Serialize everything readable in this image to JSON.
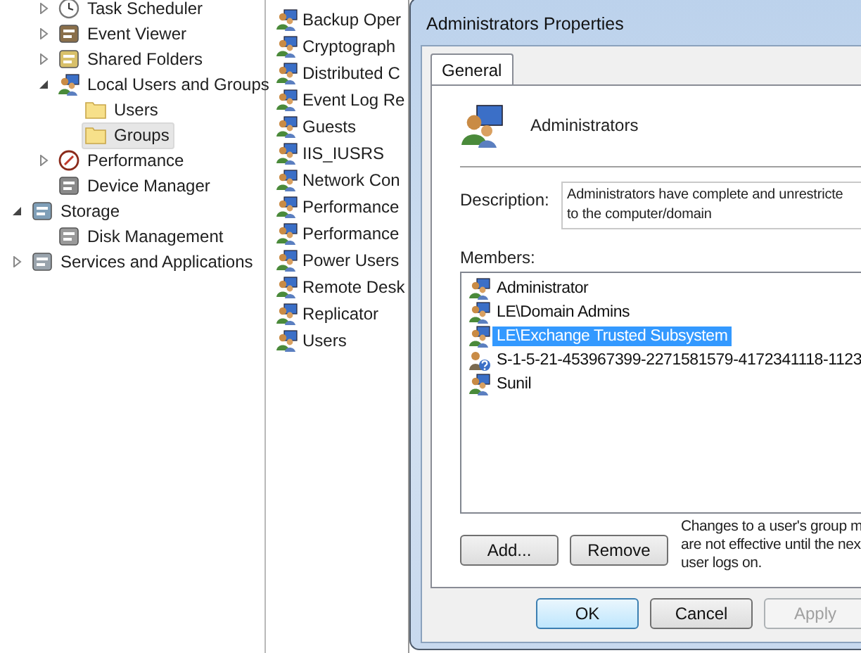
{
  "tree": [
    {
      "children": [
        {
          "label": "Task Scheduler",
          "expanded": false,
          "selected": false
        },
        {
          "label": "Event Viewer",
          "expanded": false,
          "selected": false
        },
        {
          "label": "Shared Folders",
          "expanded": false,
          "selected": false
        },
        {
          "label": "Local Users and Groups",
          "expanded": true,
          "selected": false,
          "children": [
            {
              "label": "Users",
              "selected": false
            },
            {
              "label": "Groups",
              "selected": true
            }
          ]
        },
        {
          "label": "Performance",
          "expanded": false,
          "selected": false
        },
        {
          "label": "Device Manager",
          "selected": false
        }
      ]
    },
    {
      "label": "Storage",
      "expanded": true,
      "selected": false,
      "children": [
        {
          "label": "Disk Management",
          "selected": false
        }
      ]
    },
    {
      "label": "Services and Applications",
      "expanded": false,
      "selected": false
    }
  ],
  "groups": [
    "Backup Oper",
    "Cryptograph",
    "Distributed C",
    "Event Log Re",
    "Guests",
    "IIS_IUSRS",
    "Network Con",
    "Performance",
    "Performance",
    "Power Users",
    "Remote Desk",
    "Replicator",
    "Users"
  ],
  "dialog": {
    "title": "Administrators Properties",
    "tabs": [
      {
        "label": "General",
        "selected": true
      }
    ],
    "group_name": "Administrators",
    "description_label": "Description:",
    "description_lines": [
      "Administrators have complete and unrestricte",
      "to the computer/domain"
    ],
    "members_label": "Members:",
    "members": [
      {
        "name": "Administrator",
        "kind": "user",
        "selected": false
      },
      {
        "name": "LE\\Domain Admins",
        "kind": "group",
        "selected": false
      },
      {
        "name": "LE\\Exchange Trusted Subsystem",
        "kind": "group",
        "selected": true
      },
      {
        "name": "S-1-5-21-453967399-2271581579-4172341118-1123",
        "kind": "unknown",
        "selected": false
      },
      {
        "name": "Sunil",
        "kind": "user",
        "selected": false
      }
    ],
    "add_button": "Add...",
    "remove_button": "Remove",
    "note_lines": [
      "Changes to a user's group m",
      "are not effective until the nex",
      "user logs on."
    ],
    "buttons": [
      {
        "label": "OK",
        "default": true,
        "disabled": false
      },
      {
        "label": "Cancel",
        "default": false,
        "disabled": false
      },
      {
        "label": "Apply",
        "default": false,
        "disabled": true
      }
    ]
  }
}
